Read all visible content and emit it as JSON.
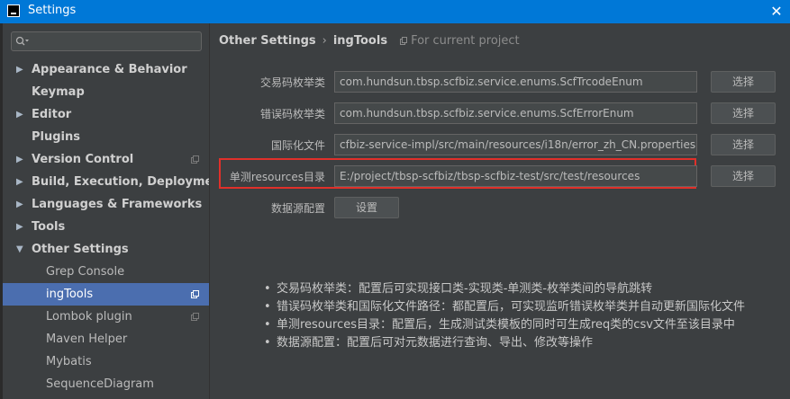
{
  "window": {
    "title": "Settings",
    "close": "✕"
  },
  "sidebar": {
    "search_placeholder": "",
    "items": [
      {
        "label": "Appearance & Behavior",
        "level": 1,
        "arrow": "▶"
      },
      {
        "label": "Keymap",
        "level": 1,
        "arrow": ""
      },
      {
        "label": "Editor",
        "level": 1,
        "arrow": "▶"
      },
      {
        "label": "Plugins",
        "level": 1,
        "arrow": ""
      },
      {
        "label": "Version Control",
        "level": 1,
        "arrow": "▶"
      },
      {
        "label": "Build, Execution, Deployment",
        "level": 1,
        "arrow": "▶"
      },
      {
        "label": "Languages & Frameworks",
        "level": 1,
        "arrow": "▶"
      },
      {
        "label": "Tools",
        "level": 1,
        "arrow": "▶"
      },
      {
        "label": "Other Settings",
        "level": 1,
        "arrow": "▼"
      },
      {
        "label": "Grep Console",
        "level": 2,
        "arrow": ""
      },
      {
        "label": "ingTools",
        "level": 2,
        "arrow": "",
        "selected": true
      },
      {
        "label": "Lombok plugin",
        "level": 2,
        "arrow": ""
      },
      {
        "label": "Maven Helper",
        "level": 2,
        "arrow": ""
      },
      {
        "label": "Mybatis",
        "level": 2,
        "arrow": ""
      },
      {
        "label": "SequenceDiagram",
        "level": 2,
        "arrow": ""
      }
    ]
  },
  "breadcrumb": {
    "parent": "Other Settings",
    "separator": "›",
    "current": "ingTools",
    "scope_note": "For current project"
  },
  "form": {
    "rows": [
      {
        "label": "交易码枚举类",
        "value": "com.hundsun.tbsp.scfbiz.service.enums.ScfTrcodeEnum",
        "button": "选择"
      },
      {
        "label": "错误码枚举类",
        "value": "com.hundsun.tbsp.scfbiz.service.enums.ScfErrorEnum",
        "button": "选择"
      },
      {
        "label": "国际化文件",
        "value": "cfbiz-service-impl/src/main/resources/i18n/error_zh_CN.properties",
        "button": "选择"
      },
      {
        "label": "单测resources目录",
        "value": "E:/project/tbsp-scfbiz/tbsp-scfbiz-test/src/test/resources",
        "button": "选择"
      }
    ],
    "datasource_label": "数据源配置",
    "datasource_button": "设置"
  },
  "notes": [
    "交易码枚举类：配置后可实现接口类-实现类-单测类-枚举类间的导航跳转",
    "错误码枚举类和国际化文件路径：都配置后，可实现监听错误枚举类并自动更新国际化文件",
    "单测resources目录：配置后，生成测试类模板的同时可生成req类的csv文件至该目录中",
    "数据源配置：配置后可对元数据进行查询、导出、修改等操作"
  ],
  "colors": {
    "background": "#3c3f41",
    "selection": "#4b6eaf",
    "titlebar": "#0078d7",
    "highlight": "#e0302a"
  },
  "icons": {
    "search": "search-icon",
    "project-scope": "project-scope-icon",
    "close": "close-icon",
    "app": "intellij-app-icon"
  }
}
